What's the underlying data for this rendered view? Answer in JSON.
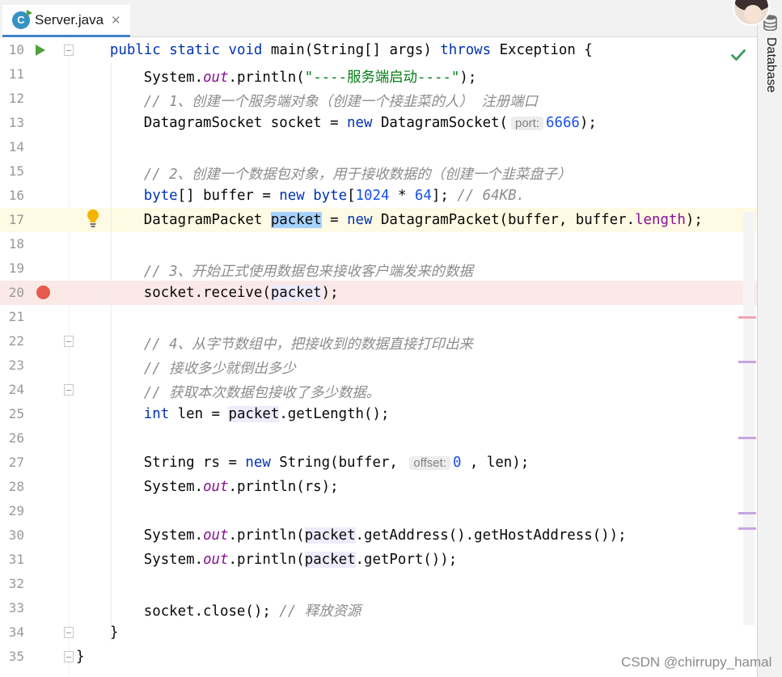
{
  "tab": {
    "label": "Server.java",
    "icon_letter": "C",
    "close": "✕"
  },
  "right_panel": {
    "label": "Database"
  },
  "watermark": "CSDN @chirrupy_hamal",
  "colors": {
    "keyword": "#0033b3",
    "comment": "#8c8c8c",
    "string": "#067d17",
    "number": "#1750eb",
    "field": "#871094",
    "breakpoint": "#e55b4d",
    "run": "#4fa23a"
  },
  "lines": [
    {
      "num": "10",
      "parts": [
        {
          "t": "    "
        },
        {
          "t": "public",
          "c": "k"
        },
        {
          "t": " "
        },
        {
          "t": "static",
          "c": "k"
        },
        {
          "t": " "
        },
        {
          "t": "void",
          "c": "k"
        },
        {
          "t": " main(String[] args) "
        },
        {
          "t": "throws",
          "c": "k"
        },
        {
          "t": " Exception {"
        }
      ]
    },
    {
      "num": "11",
      "parts": [
        {
          "t": "        System."
        },
        {
          "t": "out",
          "c": "sf"
        },
        {
          "t": ".println("
        },
        {
          "t": "\"----服务端启动----\"",
          "c": "st"
        },
        {
          "t": ");"
        }
      ]
    },
    {
      "num": "12",
      "parts": [
        {
          "t": "        "
        },
        {
          "t": "// 1、创建一个服务端对象（创建一个接韭菜的人） 注册端口",
          "c": "c"
        }
      ]
    },
    {
      "num": "13",
      "parts": [
        {
          "t": "        DatagramSocket socket = "
        },
        {
          "t": "new",
          "c": "k"
        },
        {
          "t": " DatagramSocket("
        },
        {
          "t": "port:",
          "c": "hint"
        },
        {
          "t": "6666",
          "c": "n"
        },
        {
          "t": ");"
        }
      ]
    },
    {
      "num": "14",
      "parts": []
    },
    {
      "num": "15",
      "parts": [
        {
          "t": "        "
        },
        {
          "t": "// 2、创建一个数据包对象，用于接收数据的（创建一个韭菜盘子）",
          "c": "c"
        }
      ]
    },
    {
      "num": "16",
      "parts": [
        {
          "t": "        "
        },
        {
          "t": "byte",
          "c": "k"
        },
        {
          "t": "[] buffer = "
        },
        {
          "t": "new",
          "c": "k"
        },
        {
          "t": " "
        },
        {
          "t": "byte",
          "c": "k"
        },
        {
          "t": "["
        },
        {
          "t": "1024",
          "c": "n"
        },
        {
          "t": " * "
        },
        {
          "t": "64",
          "c": "n"
        },
        {
          "t": "]; "
        },
        {
          "t": "// 64KB.",
          "c": "c"
        }
      ]
    },
    {
      "num": "17",
      "row": "caret",
      "parts": [
        {
          "t": "        DatagramPacket "
        },
        {
          "t": "packet",
          "c": "hl-sel"
        },
        {
          "t": " = "
        },
        {
          "t": "new",
          "c": "k"
        },
        {
          "t": " DatagramPacket(buffer, buffer."
        },
        {
          "t": "length",
          "c": "f"
        },
        {
          "t": ");"
        }
      ]
    },
    {
      "num": "18",
      "parts": []
    },
    {
      "num": "19",
      "parts": [
        {
          "t": "        "
        },
        {
          "t": "// 3、开始正式使用数据包来接收客户端发来的数据",
          "c": "c"
        }
      ]
    },
    {
      "num": "20",
      "row": "bp",
      "parts": [
        {
          "t": "        socket.receive("
        },
        {
          "t": "packet",
          "c": "hl-use"
        },
        {
          "t": ");"
        }
      ]
    },
    {
      "num": "21",
      "parts": []
    },
    {
      "num": "22",
      "parts": [
        {
          "t": "        "
        },
        {
          "t": "// 4、从字节数组中，把接收到的数据直接打印出来",
          "c": "c"
        }
      ]
    },
    {
      "num": "23",
      "parts": [
        {
          "t": "        "
        },
        {
          "t": "// 接收多少就倒出多少",
          "c": "c"
        }
      ]
    },
    {
      "num": "24",
      "parts": [
        {
          "t": "        "
        },
        {
          "t": "// 获取本次数据包接收了多少数据。",
          "c": "c"
        }
      ]
    },
    {
      "num": "25",
      "parts": [
        {
          "t": "        "
        },
        {
          "t": "int",
          "c": "k"
        },
        {
          "t": " len = "
        },
        {
          "t": "packet",
          "c": "hl-use"
        },
        {
          "t": ".getLength();"
        }
      ]
    },
    {
      "num": "26",
      "parts": []
    },
    {
      "num": "27",
      "parts": [
        {
          "t": "        String rs = "
        },
        {
          "t": "new",
          "c": "k"
        },
        {
          "t": " String(buffer, "
        },
        {
          "t": "offset:",
          "c": "hint"
        },
        {
          "t": "0",
          "c": "n"
        },
        {
          "t": " , len);"
        }
      ]
    },
    {
      "num": "28",
      "parts": [
        {
          "t": "        System."
        },
        {
          "t": "out",
          "c": "sf"
        },
        {
          "t": ".println(rs);"
        }
      ]
    },
    {
      "num": "29",
      "parts": []
    },
    {
      "num": "30",
      "parts": [
        {
          "t": "        System."
        },
        {
          "t": "out",
          "c": "sf"
        },
        {
          "t": ".println("
        },
        {
          "t": "packet",
          "c": "hl-use"
        },
        {
          "t": ".getAddress().getHostAddress());"
        }
      ]
    },
    {
      "num": "31",
      "parts": [
        {
          "t": "        System."
        },
        {
          "t": "out",
          "c": "sf"
        },
        {
          "t": ".println("
        },
        {
          "t": "packet",
          "c": "hl-use"
        },
        {
          "t": ".getPort());"
        }
      ]
    },
    {
      "num": "32",
      "parts": []
    },
    {
      "num": "33",
      "parts": [
        {
          "t": "        socket.close(); "
        },
        {
          "t": "// 释放资源",
          "c": "c"
        }
      ]
    },
    {
      "num": "34",
      "parts": [
        {
          "t": "    }"
        }
      ]
    },
    {
      "num": "35",
      "parts": [
        {
          "t": "}"
        }
      ]
    }
  ]
}
